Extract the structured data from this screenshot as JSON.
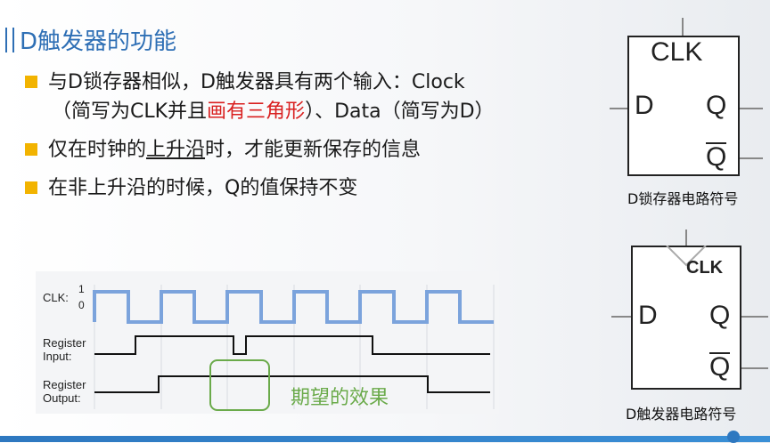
{
  "title": "D触发器的功能",
  "bullets": {
    "b1_part1": "与D锁存器相似，D触发器具有两个输入：Clock",
    "b1_part2": "（简写为CLK并且",
    "b1_red": "画有三角形",
    "b1_part3": "）、Data（简写为D）",
    "b2_pre": "仅在时钟的",
    "b2_ul": "上升沿",
    "b2_post": "时，才能更新保存的信息",
    "b3": "在非上升沿的时候，Q的值保持不变"
  },
  "timing": {
    "clk_label": "CLK:",
    "clk_one": "1",
    "clk_zero": "0",
    "input_label_1": "Register",
    "input_label_2": "Input:",
    "output_label_1": "Register",
    "output_label_2": "Output:",
    "annotation": "期望的效果"
  },
  "latch": {
    "clk": "CLK",
    "d": "D",
    "q": "Q",
    "qbar": "Q",
    "caption": "D锁存器电路符号"
  },
  "flipflop": {
    "clk": "CLK",
    "d": "D",
    "q": "Q",
    "qbar": "Q",
    "caption": "D触发器电路符号"
  },
  "colors": {
    "title": "#2e6fb5",
    "bullet": "#f2b300",
    "highlight": "#d92020",
    "clock_wave": "#7ba3dc",
    "annotation": "#6aaa4a"
  }
}
